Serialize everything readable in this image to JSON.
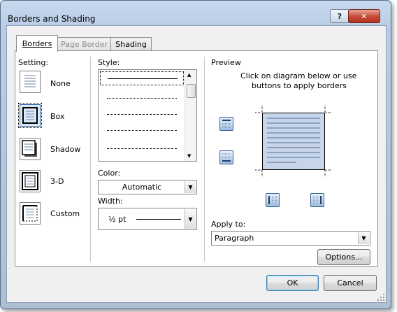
{
  "window": {
    "title": "Borders and Shading",
    "help_glyph": "?",
    "close_glyph": "✕"
  },
  "tabs": [
    {
      "label": "Borders",
      "state": "active"
    },
    {
      "label": "Page Border",
      "state": "disabled"
    },
    {
      "label": "Shading",
      "state": "normal"
    }
  ],
  "setting": {
    "label": "Setting:",
    "options": [
      {
        "label": "None",
        "selected": false
      },
      {
        "label": "Box",
        "selected": true
      },
      {
        "label": "Shadow",
        "selected": false
      },
      {
        "label": "3-D",
        "selected": false
      },
      {
        "label": "Custom",
        "selected": false
      }
    ]
  },
  "style": {
    "label": "Style:",
    "items": [
      "solid",
      "dotted",
      "dashed-fine",
      "dashed",
      "dash-dot"
    ]
  },
  "color": {
    "label": "Color:",
    "value": "Automatic"
  },
  "width": {
    "label": "Width:",
    "value": "½ pt"
  },
  "preview": {
    "label": "Preview",
    "instructions_line1": "Click on diagram below or use",
    "instructions_line2": "buttons to apply borders"
  },
  "apply_to": {
    "label": "Apply to:",
    "value": "Paragraph"
  },
  "buttons": {
    "options": "Options...",
    "ok": "OK",
    "cancel": "Cancel"
  },
  "icons": [
    "help-icon",
    "close-icon",
    "dropdown-arrow-icon",
    "scroll-up-icon",
    "scroll-down-icon",
    "top-border-icon",
    "bottom-border-icon",
    "left-border-icon",
    "right-border-icon"
  ]
}
